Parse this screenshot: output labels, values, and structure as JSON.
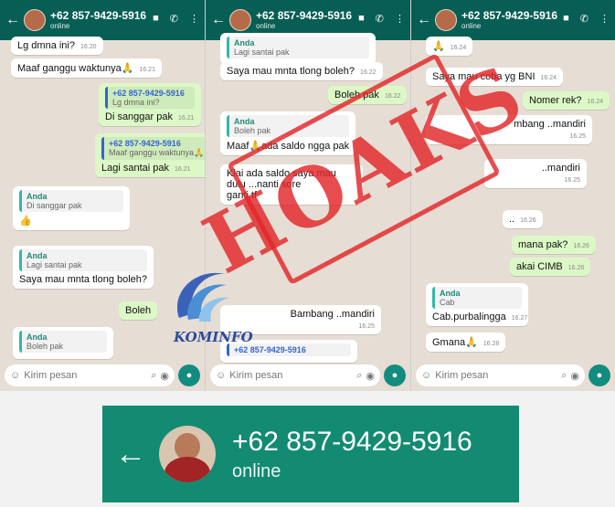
{
  "contact": {
    "number": "+62 857-9429-5916",
    "status": "online"
  },
  "panels": [
    {
      "messages": [
        {
          "dir": "in",
          "text": "Lg dmna ini?",
          "time": "16.20"
        },
        {
          "dir": "in",
          "text": "Maaf ganggu waktunya🙏",
          "time": "16.21"
        },
        {
          "dir": "out",
          "quote_name": "+62 857-9429-5916",
          "quote_text": "Lg dmna ini?",
          "text": "Di sanggar pak",
          "time": "16.21"
        },
        {
          "dir": "out",
          "quote_name": "+62 857-9429-5916",
          "quote_text": "Maaf ganggu waktunya🙏",
          "text": "Lagi santai pak",
          "time": "16.21"
        },
        {
          "dir": "in",
          "quote_name": "Anda",
          "quote_text": "Di sanggar pak",
          "text": "👍"
        },
        {
          "dir": "in",
          "quote_name": "Anda",
          "quote_text": "Lagi santai pak",
          "text": "Saya mau mnta tlong boleh?"
        },
        {
          "dir": "out",
          "text": "Boleh"
        },
        {
          "dir": "in",
          "quote_name": "Anda",
          "quote_text": "Boleh pak",
          "text": ""
        }
      ],
      "input_placeholder": "Kirim pesan"
    },
    {
      "messages": [
        {
          "dir": "in",
          "quote_name": "Anda",
          "quote_text": "Lagi santai pak",
          "text": ""
        },
        {
          "dir": "in",
          "text": "Saya mau mnta tlong boleh?",
          "time": "16.22"
        },
        {
          "dir": "out",
          "text": "Boleh pak",
          "time": "16.22"
        },
        {
          "dir": "in",
          "quote_name": "Anda",
          "quote_text": "Boleh pak",
          "text": "Maaf🙏ada saldo ngga pak"
        },
        {
          "dir": "in",
          "text": "Klai ada saldo saya mau",
          "text2": "dulu ...nanti sore",
          "text3": "ganti tf"
        },
        {
          "dir": "in",
          "text": "Bambang ..mandiri",
          "time": "16.25"
        },
        {
          "dir": "in",
          "quote_name": "+62 857-9429-5916",
          "text": ""
        }
      ],
      "input_placeholder": "Kirim pesan"
    },
    {
      "messages": [
        {
          "dir": "in",
          "text": "🙏",
          "time": "16.24"
        },
        {
          "dir": "in",
          "text": "Saya mau coba yg BNI",
          "time": "16.24"
        },
        {
          "dir": "out",
          "text": "Nomer rek?",
          "time": "16.24"
        },
        {
          "dir": "in",
          "text": "mbang ..mandiri",
          "time": "16.25"
        },
        {
          "dir": "in",
          "text": "..mandiri",
          "time": "16.25"
        },
        {
          "dir": "in",
          "text": "..",
          "time": "16.26"
        },
        {
          "dir": "out",
          "text": "mana pak?",
          "time": "16.26"
        },
        {
          "dir": "out",
          "text": "akai CIMB",
          "time": "16.26"
        },
        {
          "dir": "in",
          "quote_name": "Anda",
          "quote_text": "Cab",
          "text": "Cab.purbalingga",
          "time": "16.27"
        },
        {
          "dir": "in",
          "text": "Gmana🙏",
          "time": "16.28"
        }
      ],
      "input_placeholder": "Kirim pesan"
    }
  ],
  "stamp_text": "HOAKS",
  "logo_text": "KOMINFO",
  "zoom": {
    "number": "+62 857-9429-5916",
    "status": "online"
  },
  "colors": {
    "header": "#075e54",
    "outgoing": "#dcf8c6",
    "stamp": "#e22628",
    "zoom_bg": "#138b72"
  }
}
